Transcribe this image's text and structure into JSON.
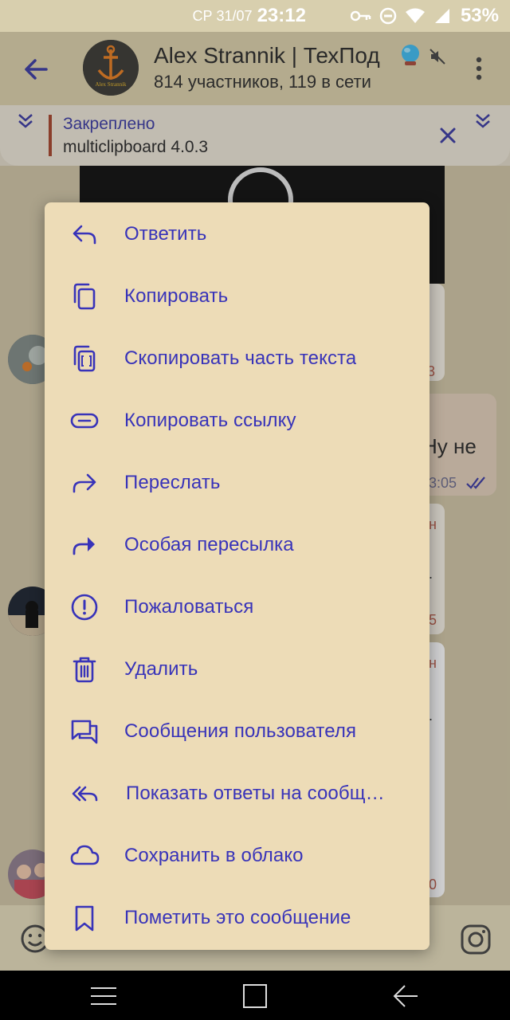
{
  "status_bar": {
    "date": "СР 31/07",
    "time": "23:12",
    "battery": "53%"
  },
  "header": {
    "title": "Alex Strannik | ТехПод",
    "subtitle": "814 участников, 119 в сети",
    "avatar_text": "Alex Strannik"
  },
  "pinned": {
    "label": "Закреплено",
    "text": "multiclipboard 4.0.3"
  },
  "background_peek": {
    "msg_fragment": "Ну не",
    "time_fragment": "3:05",
    "red_1": "3",
    "red_2": "н",
    "red_3": "5",
    "red_4": "н",
    "red_5": "0",
    "dot_1": ".",
    "dot_2": "."
  },
  "menu": {
    "items": [
      {
        "label": "Ответить",
        "icon": "reply-icon"
      },
      {
        "label": "Копировать",
        "icon": "copy-icon"
      },
      {
        "label": "Скопировать часть текста",
        "icon": "copy-part-icon"
      },
      {
        "label": "Копировать ссылку",
        "icon": "link-icon"
      },
      {
        "label": "Переслать",
        "icon": "forward-icon"
      },
      {
        "label": "Особая пересылка",
        "icon": "forward-special-icon"
      },
      {
        "label": "Пожаловаться",
        "icon": "report-icon"
      },
      {
        "label": "Удалить",
        "icon": "delete-icon"
      },
      {
        "label": "Сообщения пользователя",
        "icon": "user-messages-icon"
      },
      {
        "label": "Показать ответы на сообщ…",
        "icon": "reply-all-icon"
      },
      {
        "label": "Сохранить в облако",
        "icon": "cloud-icon"
      },
      {
        "label": "Пометить это сообщение",
        "icon": "bookmark-icon"
      }
    ]
  },
  "colors": {
    "menu_bg": "#eddcb7",
    "menu_accent": "#3833b9",
    "header_bg": "#d3c8a5"
  }
}
